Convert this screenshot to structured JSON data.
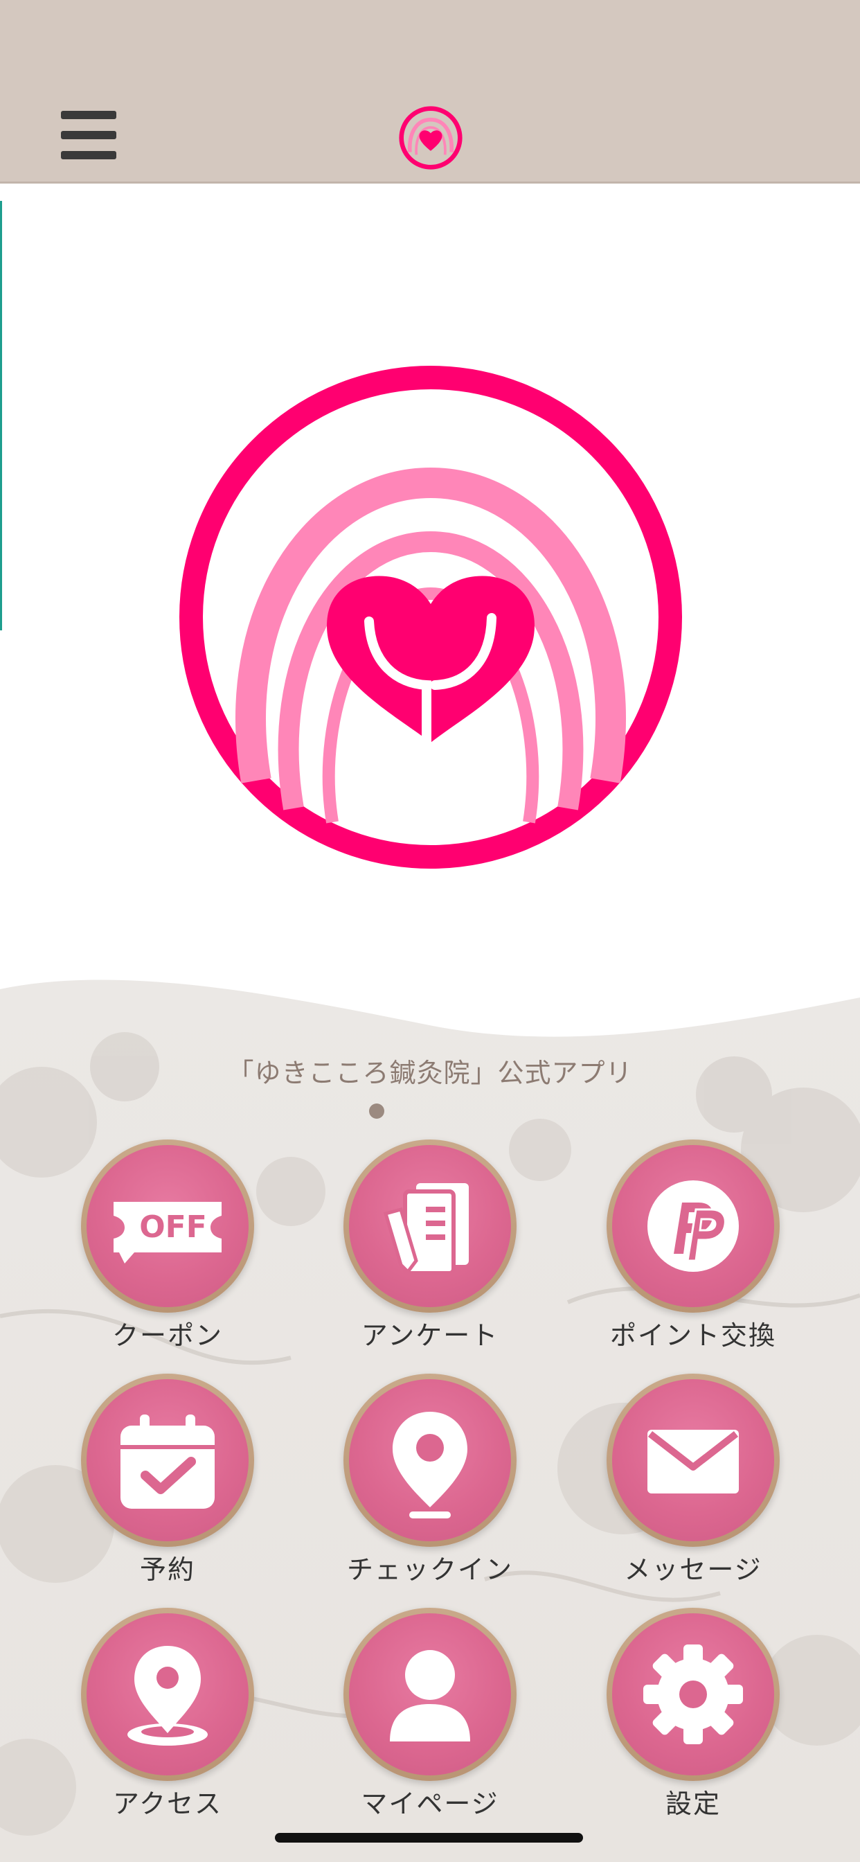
{
  "app": {
    "title": "「ゆきこころ鍼灸院」公式アプリ",
    "brand_pink": "#ff0070",
    "light_pink": "#ff86b8",
    "button_pink": "#dc6790",
    "header_bg": "#d4c8bf"
  },
  "header": {
    "menu_icon": "hamburger-menu-icon",
    "logo_icon": "heart-logo-icon"
  },
  "pagination": {
    "current": 1,
    "total": 1
  },
  "menu": [
    {
      "id": "coupon",
      "label": "クーポン",
      "icon": "coupon-off-icon",
      "icon_text": "OFF"
    },
    {
      "id": "survey",
      "label": "アンケート",
      "icon": "survey-icon"
    },
    {
      "id": "points",
      "label": "ポイント交換",
      "icon": "point-exchange-icon"
    },
    {
      "id": "reservation",
      "label": "予約",
      "icon": "calendar-check-icon"
    },
    {
      "id": "checkin",
      "label": "チェックイン",
      "icon": "map-pin-icon"
    },
    {
      "id": "message",
      "label": "メッセージ",
      "icon": "envelope-icon"
    },
    {
      "id": "access",
      "label": "アクセス",
      "icon": "location-icon"
    },
    {
      "id": "mypage",
      "label": "マイページ",
      "icon": "user-icon"
    },
    {
      "id": "settings",
      "label": "設定",
      "icon": "gear-icon"
    }
  ]
}
